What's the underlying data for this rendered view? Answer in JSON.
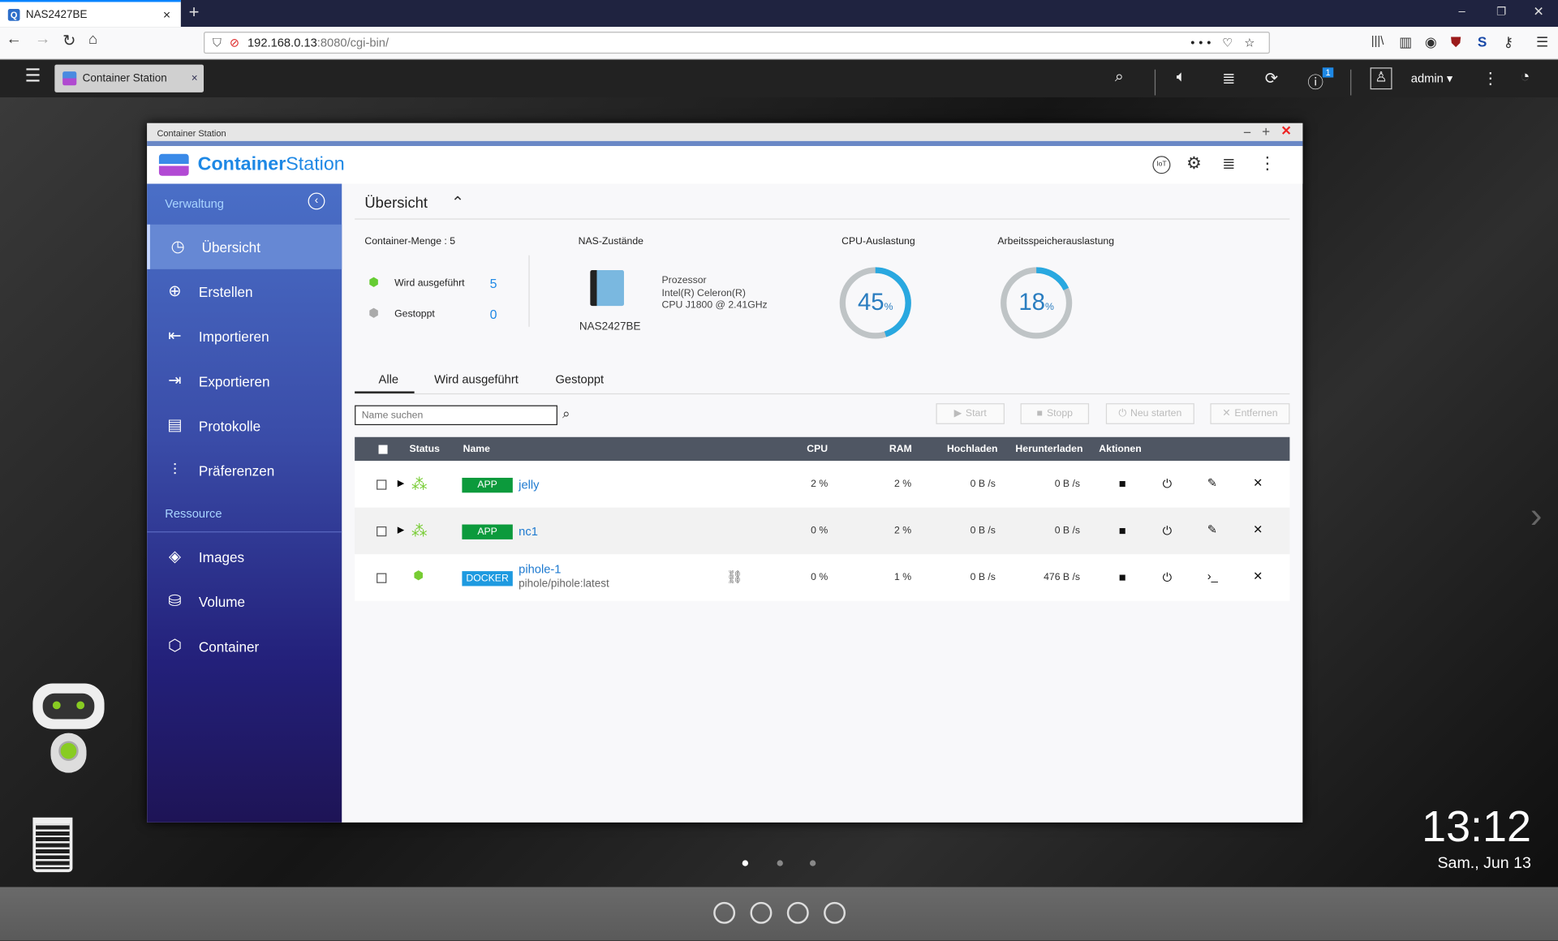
{
  "browser": {
    "tab_title": "NAS2427BE",
    "url_host": "192.168.0.13",
    "url_rest": ":8080/cgi-bin/"
  },
  "qts": {
    "open_app_tab": "Container Station",
    "user": "admin",
    "notification_count": "1"
  },
  "window": {
    "title": "Container Station",
    "logo_bold": "Container",
    "logo_light": "Station"
  },
  "sidebar": {
    "section1": "Verwaltung",
    "items": [
      {
        "label": "Übersicht",
        "icon": "dashboard-icon"
      },
      {
        "label": "Erstellen",
        "icon": "plus-circle-icon"
      },
      {
        "label": "Importieren",
        "icon": "import-icon"
      },
      {
        "label": "Exportieren",
        "icon": "export-icon"
      },
      {
        "label": "Protokolle",
        "icon": "log-icon"
      },
      {
        "label": "Präferenzen",
        "icon": "sliders-icon"
      }
    ],
    "section2": "Ressource",
    "items2": [
      {
        "label": "Images",
        "icon": "layers-icon"
      },
      {
        "label": "Volume",
        "icon": "database-icon"
      },
      {
        "label": "Container",
        "icon": "cube-icon"
      }
    ]
  },
  "overview": {
    "title": "Übersicht",
    "container_count_label": "Container-Menge : 5",
    "running_label": "Wird ausgeführt",
    "running_value": "5",
    "stopped_label": "Gestoppt",
    "stopped_value": "0",
    "nas_label": "NAS-Zustände",
    "nas_name": "NAS2427BE",
    "cpu_title": "Prozessor",
    "cpu_line1": "Intel(R) Celeron(R)",
    "cpu_line2": "CPU J1800 @ 2.41GHz",
    "cpu_usage_label": "CPU-Auslastung",
    "cpu_usage": 45,
    "mem_usage_label": "Arbeitsspeicherauslastung",
    "mem_usage": 18,
    "percent": "%",
    "accent": "#29a8e0"
  },
  "filters": {
    "tabs": [
      "Alle",
      "Wird ausgeführt",
      "Gestoppt"
    ],
    "active": "Alle",
    "search_placeholder": "Name suchen",
    "buttons": [
      "Start",
      "Stopp",
      "Neu starten",
      "Entfernen"
    ]
  },
  "table": {
    "headers": [
      "Status",
      "Name",
      "CPU",
      "RAM",
      "Hochladen",
      "Herunterladen",
      "Aktionen"
    ],
    "rows": [
      {
        "type": "APP",
        "name": "jelly",
        "sub": "",
        "cpu": "2 %",
        "ram": "2 %",
        "up": "0 B /s",
        "down": "0 B /s"
      },
      {
        "type": "APP",
        "name": "nc1",
        "sub": "",
        "cpu": "0 %",
        "ram": "2 %",
        "up": "0 B /s",
        "down": "0 B /s"
      },
      {
        "type": "DOCKER",
        "name": "pihole-1",
        "sub": "pihole/pihole:latest",
        "cpu": "0 %",
        "ram": "1 %",
        "up": "0 B /s",
        "down": "476 B /s"
      }
    ],
    "app_color": "#0c9a3c",
    "docker_color": "#1e9ae0"
  },
  "clock": {
    "time": "13:12",
    "date": "Sam., Jun 13"
  }
}
